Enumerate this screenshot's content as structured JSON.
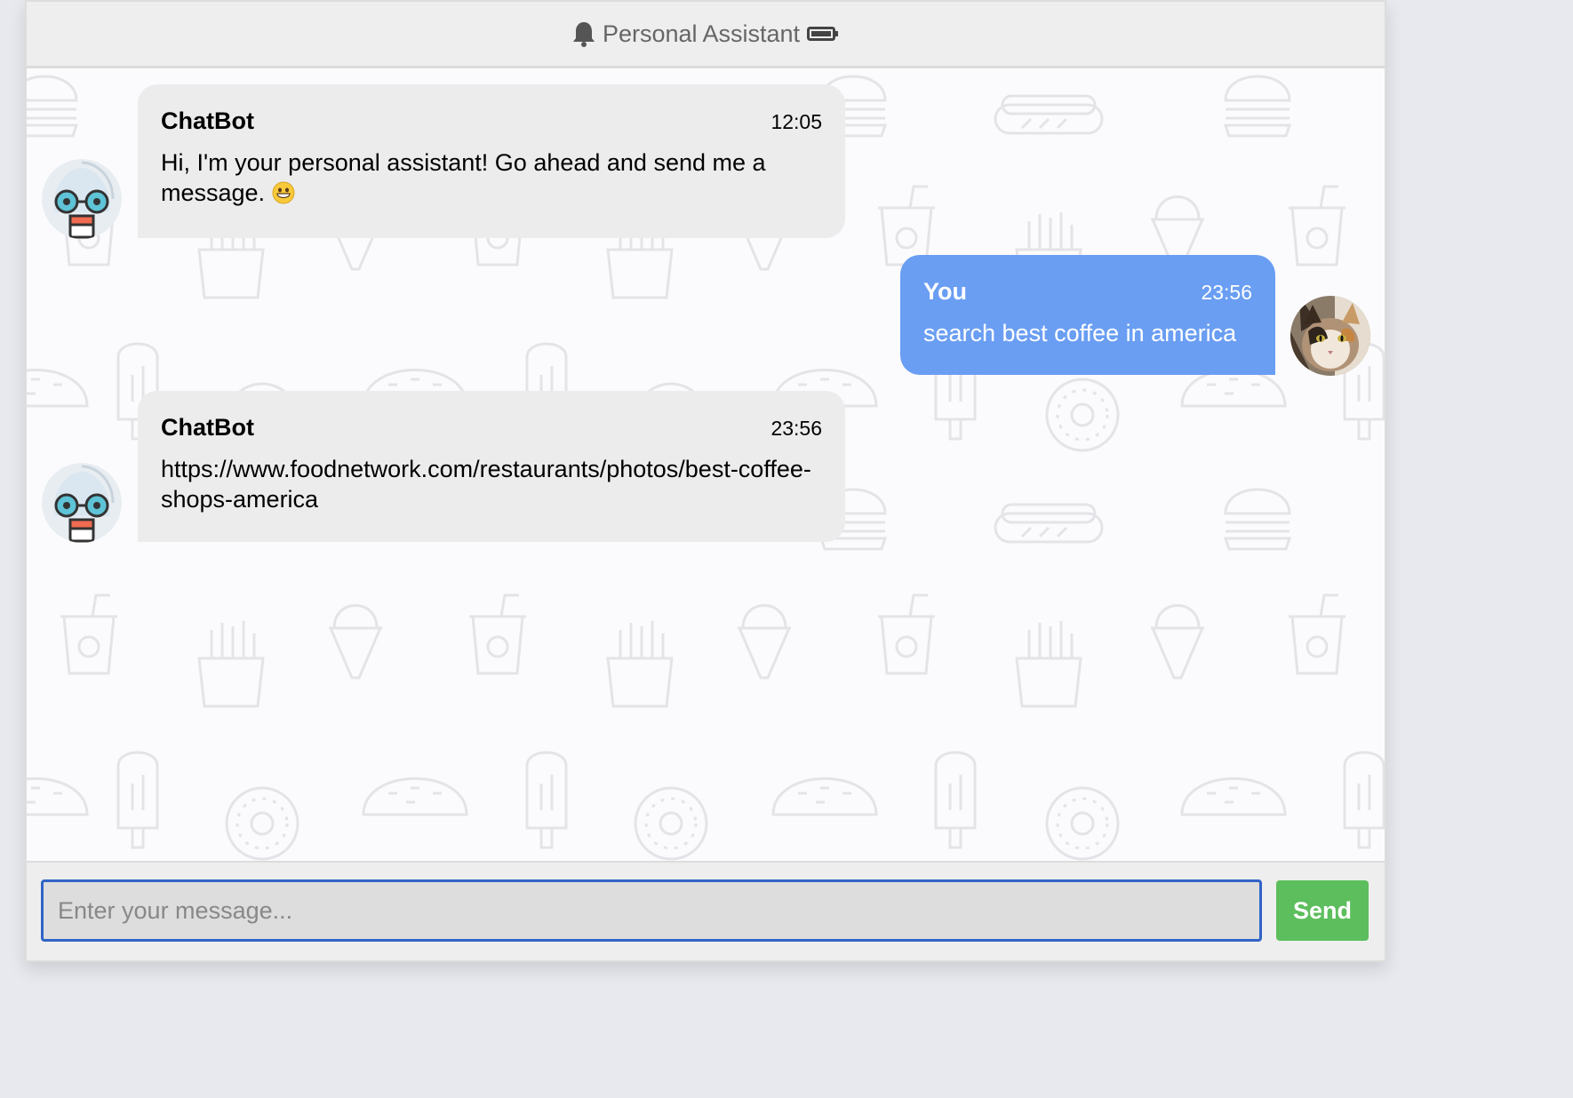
{
  "header": {
    "title": "Personal Assistant",
    "bell_icon": "bell-icon",
    "battery_icon": "battery-icon"
  },
  "messages": [
    {
      "sender": "ChatBot",
      "time": "12:05",
      "text": "Hi, I'm your personal assistant! Go ahead and send me a message.",
      "emoji": "grinning-face-emoji",
      "side": "left",
      "avatar": "robot-avatar"
    },
    {
      "sender": "You",
      "time": "23:56",
      "text": "search best coffee in america",
      "side": "right",
      "avatar": "cat-avatar"
    },
    {
      "sender": "ChatBot",
      "time": "23:56",
      "text": "https://www.foodnetwork.com/restaurants/photos/best-coffee-shops-america",
      "side": "left",
      "avatar": "robot-avatar"
    }
  ],
  "composer": {
    "placeholder": "Enter your message...",
    "value": "",
    "send_label": "Send"
  },
  "colors": {
    "user_bubble": "#6a9ef3",
    "bot_bubble": "#ececec",
    "send_button": "#5cbe5c",
    "input_border": "#2f63c6"
  }
}
